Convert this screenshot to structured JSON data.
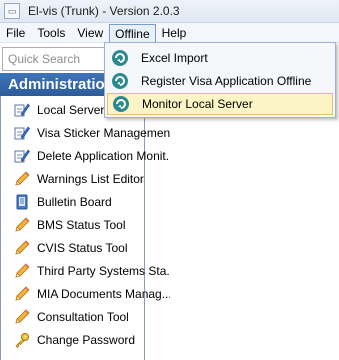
{
  "window": {
    "title": "El-vis (Trunk) - Version 2.0.3",
    "app_icon": "app-window-icon"
  },
  "menubar": {
    "items": [
      {
        "label": "File"
      },
      {
        "label": "Tools"
      },
      {
        "label": "View"
      },
      {
        "label": "Offline",
        "active": true
      },
      {
        "label": "Help"
      }
    ]
  },
  "search": {
    "placeholder": "Quick Search",
    "value": ""
  },
  "sidebar": {
    "header": "Administration",
    "items": [
      {
        "label": "Local Server",
        "icon": "edit-pencil-icon"
      },
      {
        "label": "Visa Sticker Management",
        "icon": "edit-pencil-icon"
      },
      {
        "label": "Delete Application Monit...",
        "icon": "edit-pencil-icon"
      },
      {
        "label": "Warnings List Editor",
        "icon": "pencil-icon"
      },
      {
        "label": "Bulletin Board",
        "icon": "bulletin-board-icon"
      },
      {
        "label": "BMS Status Tool",
        "icon": "pencil-icon"
      },
      {
        "label": "CVIS Status Tool",
        "icon": "pencil-icon"
      },
      {
        "label": "Third Party Systems Sta...",
        "icon": "pencil-icon"
      },
      {
        "label": "MIA Documents Manag...",
        "icon": "pencil-icon"
      },
      {
        "label": "Consultation Tool",
        "icon": "pencil-icon"
      },
      {
        "label": "Change Password",
        "icon": "key-icon"
      }
    ]
  },
  "offline_menu": {
    "items": [
      {
        "label": "Excel Import",
        "icon": "offline-swirl-icon"
      },
      {
        "label": "Register Visa Application Offline",
        "icon": "offline-swirl-icon"
      },
      {
        "label": "Monitor Local Server",
        "icon": "offline-swirl-icon",
        "highlighted": true
      }
    ]
  },
  "colors": {
    "header_bg": "#3566a8",
    "menu_highlight": "#fdf4c6",
    "menu_highlight_border": "#e5c365",
    "offline_icon": "#2a8a8e"
  }
}
